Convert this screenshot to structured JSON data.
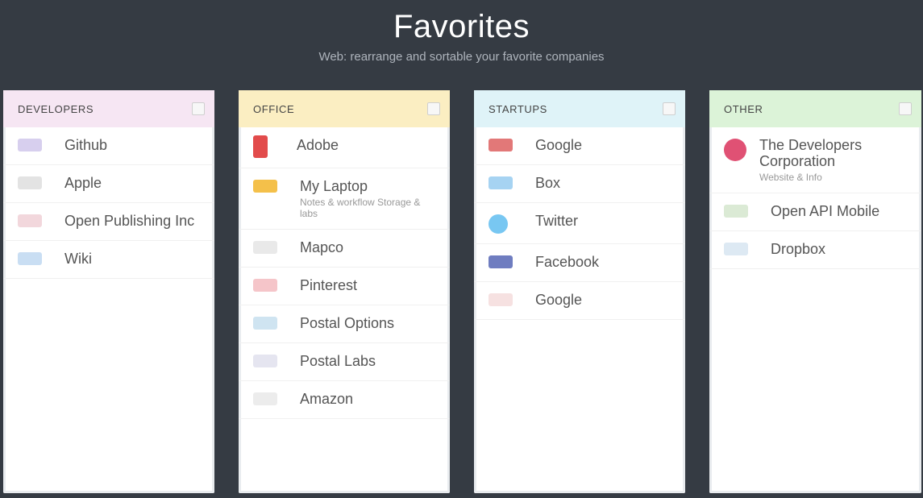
{
  "header": {
    "title": "Favorites",
    "subtitle": "Web: rearrange and sortable your favorite companies"
  },
  "columns": [
    {
      "title": "DEVELOPERS",
      "color": "#f6e6f3",
      "items": [
        {
          "name": "Github",
          "logo": "github-logo",
          "logo_color": "#d7cfee"
        },
        {
          "name": "Apple",
          "logo": "apple-logo",
          "logo_color": "#e3e3e3"
        },
        {
          "name": "Open Publishing Inc",
          "logo": "publishing-logo",
          "logo_color": "#f2d7dc"
        },
        {
          "name": "Wiki",
          "logo": "wiki-logo",
          "logo_color": "#c9def3"
        }
      ]
    },
    {
      "title": "OFFICE",
      "color": "#fbeec2",
      "items": [
        {
          "name": "Adobe",
          "logo": "adobe-logo",
          "logo_color": "#e24b4b"
        },
        {
          "name": "My Laptop",
          "desc": "Notes & workflow Storage & labs",
          "logo": "laptop-logo",
          "logo_color": "#f4c04a"
        },
        {
          "name": "Mapco",
          "logo": "mapco-logo",
          "logo_color": "#e9e9e9"
        },
        {
          "name": "Pinterest",
          "logo": "pinterest-logo",
          "logo_color": "#f5c5c9"
        },
        {
          "name": "Postal Options",
          "logo": "postal-logo",
          "logo_color": "#cfe4f1"
        },
        {
          "name": "Postal Labs",
          "logo": "postal-labs-logo",
          "logo_color": "#e5e5f0"
        },
        {
          "name": "Amazon",
          "logo": "amazon-logo",
          "logo_color": "#ececec"
        }
      ]
    },
    {
      "title": "STARTUPS",
      "color": "#dff3f8",
      "items": [
        {
          "name": "Google",
          "logo": "google-logo",
          "logo_color": "#e27878"
        },
        {
          "name": "Box",
          "logo": "box-logo",
          "logo_color": "#a6d3f2"
        },
        {
          "name": "Twitter",
          "logo": "twitter-logo",
          "logo_color": "#78c7f2"
        },
        {
          "name": "Facebook",
          "logo": "facebook-logo",
          "logo_color": "#6f7dc0"
        },
        {
          "name": "Google",
          "logo": "google-plus-logo",
          "logo_color": "#f6e1e1"
        }
      ]
    },
    {
      "title": "OTHER",
      "color": "#dcf3d8",
      "items": [
        {
          "name": "The Developers Corporation",
          "desc": "Website & Info",
          "logo": "dev-corp-logo",
          "logo_color": "#e05174"
        },
        {
          "name": "Open API Mobile",
          "logo": "api-logo",
          "logo_color": "#dbead5"
        },
        {
          "name": "Dropbox",
          "logo": "dropbox-logo",
          "logo_color": "#dde9f3"
        }
      ]
    }
  ]
}
